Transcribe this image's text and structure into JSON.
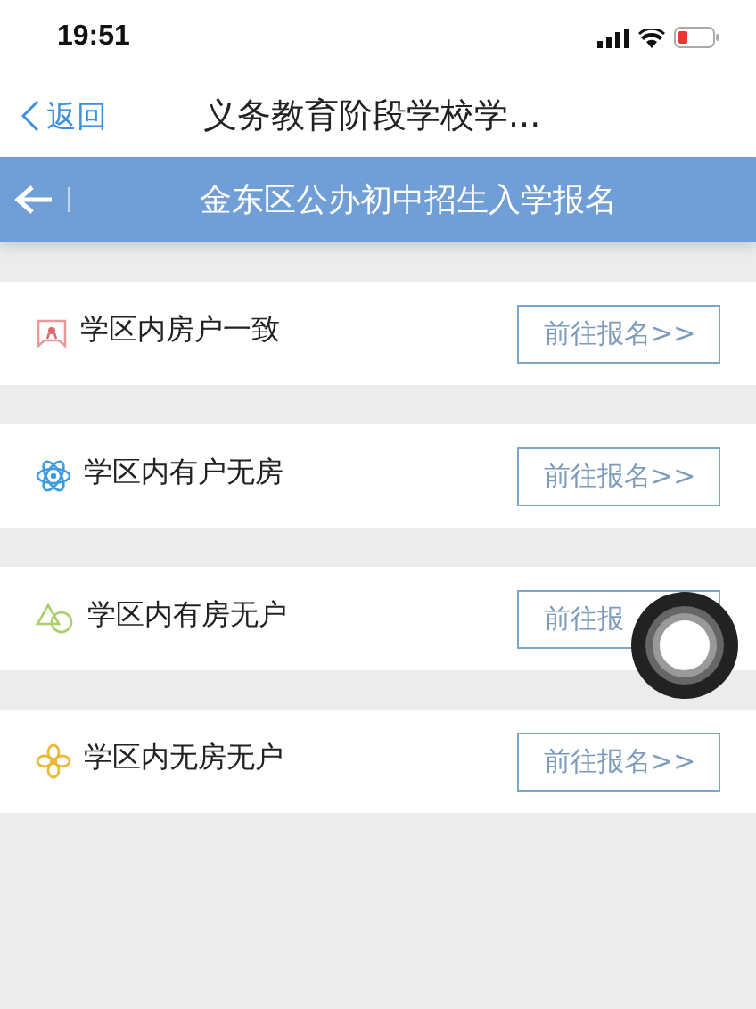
{
  "status_bar": {
    "time": "19:51"
  },
  "nav": {
    "back": "返回",
    "title": "义务教育阶段学校学..."
  },
  "header": {
    "title": "金东区公办初中招生入学报名"
  },
  "items": [
    {
      "kind": "certificate",
      "label": "学区内房户一致",
      "button": "前往报名>>"
    },
    {
      "kind": "atom",
      "label": "学区内有户无房",
      "button": "前往报名>>"
    },
    {
      "kind": "triangles",
      "label": "学区内有房无户",
      "button": "前往报"
    },
    {
      "kind": "flower",
      "label": "学区内无房无户",
      "button": "前往报名>>"
    }
  ]
}
